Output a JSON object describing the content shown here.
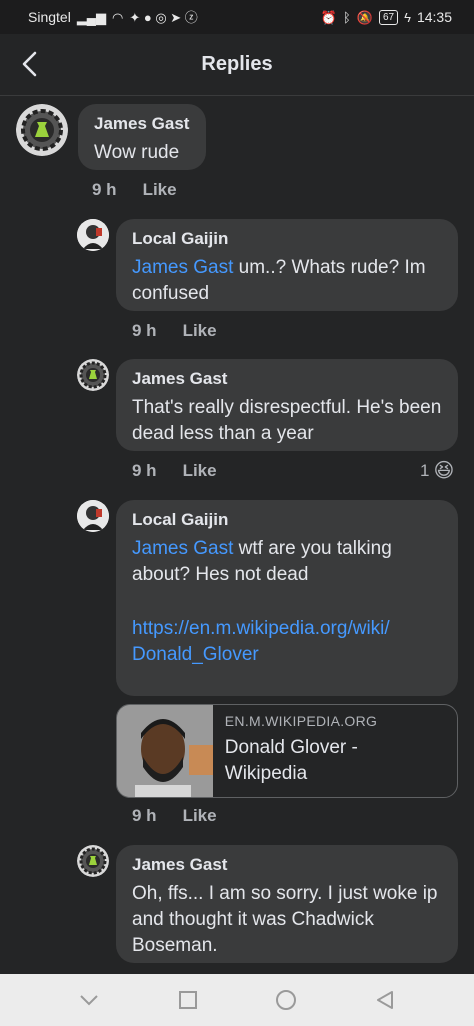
{
  "status_bar": {
    "carrier": "Singtel",
    "battery": "67",
    "time": "14:35"
  },
  "header": {
    "title": "Replies"
  },
  "comments": [
    {
      "author": "James Gast",
      "text": "Wow rude",
      "time": "9 h",
      "like_label": "Like"
    },
    {
      "author": "Local Gaijin",
      "mention": "James Gast",
      "text": " um..? Whats rude? Im confused",
      "time": "9 h",
      "like_label": "Like"
    },
    {
      "author": "James Gast",
      "text": "That's really disrespectful. He's been dead less than a year",
      "time": "9 h",
      "like_label": "Like",
      "reaction_count": "1",
      "reaction_emoji": "😆"
    },
    {
      "author": "Local Gaijin",
      "mention": "James Gast",
      "text": " wtf are you talking about? Hes not dead",
      "link": "https://en.m.wikipedia.org/wiki/Donald_Glover",
      "link_line1": "https://en.m.wikipedia.org/wiki/",
      "link_line2": "Donald_Glover",
      "card": {
        "domain": "EN.M.WIKIPEDIA.ORG",
        "title": "Donald Glover - Wikipedia"
      },
      "time": "9 h",
      "like_label": "Like"
    },
    {
      "author": "James Gast",
      "text": "Oh, ffs... I am so sorry. I just woke ip and thought it was Chadwick Boseman."
    }
  ]
}
